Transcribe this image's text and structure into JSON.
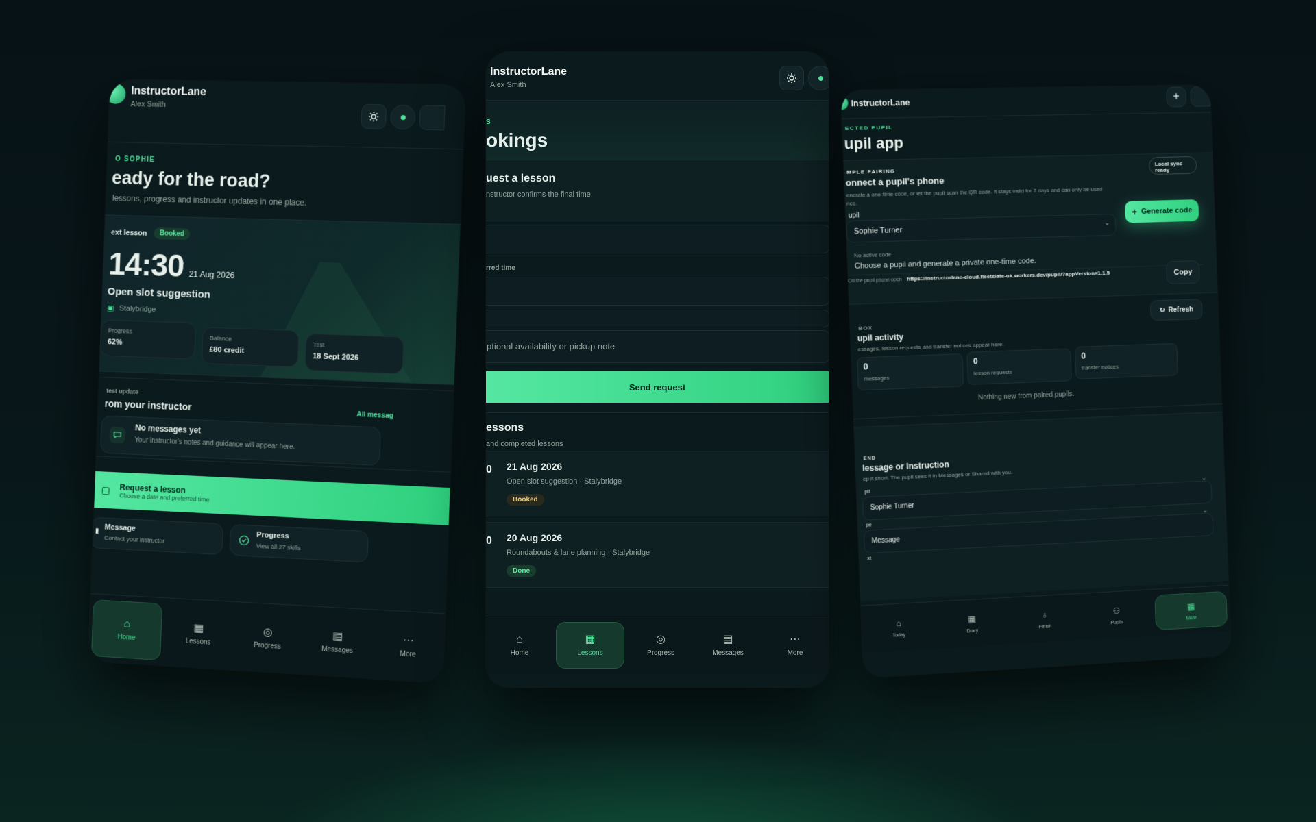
{
  "phone1": {
    "brand": "InstructorLane",
    "user": "Alex Smith",
    "greeting_eyebrow": "O SOPHIE",
    "hero_title": "eady for the road?",
    "hero_sub": "lessons, progress and instructor updates in one place.",
    "next_label": "ext lesson",
    "next_badge": "Booked",
    "next_time": "14:30",
    "next_date": "21 Aug 2026",
    "next_title": "Open slot suggestion",
    "next_location": "Stalybridge",
    "stats": [
      {
        "label": "Progress",
        "value": "62%"
      },
      {
        "label": "Balance",
        "value": "£80 credit"
      },
      {
        "label": "Test",
        "value": "18 Sept 2026"
      }
    ],
    "update_eyebrow": "test update",
    "update_title": "rom your instructor",
    "update_link": "All messag",
    "empty_title": "No messages yet",
    "empty_sub": "Your instructor's notes and guidance will appear here.",
    "cta_title": "Request a lesson",
    "cta_sub": "Choose a date and preferred time",
    "quick": [
      {
        "title": "Message",
        "sub": "Contact your instructor"
      },
      {
        "title": "Progress",
        "sub": "View all 27 skills"
      }
    ],
    "tabs": [
      "Home",
      "Lessons",
      "Progress",
      "Messages",
      "More"
    ]
  },
  "phone2": {
    "brand": "InstructorLane",
    "user": "Alex Smith",
    "eyebrow": "S",
    "page_title": "okings",
    "request_title": "uest a lesson",
    "request_sub": "nstructor confirms the final time.",
    "preferred_label": "rred time",
    "note_placeholder": "ptional availability or pickup note",
    "send_label": "Send request",
    "lessons_title": "essons",
    "lessons_sub": "and completed lessons",
    "lessons": [
      {
        "num": "0",
        "date": "21 Aug 2026",
        "desc": "Open slot suggestion · Stalybridge",
        "status": "Booked"
      },
      {
        "num": "0",
        "date": "20 Aug 2026",
        "desc": "Roundabouts & lane planning · Stalybridge",
        "status": "Done"
      }
    ],
    "tabs": [
      "Home",
      "Lessons",
      "Progress",
      "Messages",
      "More"
    ]
  },
  "phone3": {
    "brand": "InstructorLane",
    "eyebrow": "ECTED PUPIL",
    "page_title": "upil app",
    "pairing_eyebrow": "MPLE PAIRING",
    "pairing_title": "onnect a pupil's phone",
    "pairing_sub": "enerate a one-time code, or let the pupil scan the QR code. It stays valid for 7 days and can only be used",
    "pairing_sub2": "nce.",
    "sync_badge": "Local sync ready",
    "pupil_label": "upil",
    "pupil_value": "Sophie Turner",
    "generate_label": "Generate code",
    "code_label": "No active code",
    "code_sub": "Choose a pupil and generate a private one-time code.",
    "open_label": "On the pupil phone open",
    "url": "https://instructorlane-cloud.fleetslate-uk.workers.dev/pupil/?appVersion=1.1.5",
    "copy_label": "Copy",
    "inbox_eyebrow": "BOX",
    "inbox_title": "upil activity",
    "inbox_sub": "essages, lesson requests and transfer notices appear here.",
    "refresh_label": "Refresh",
    "counters": [
      {
        "value": "0",
        "label": "messages"
      },
      {
        "value": "0",
        "label": "lesson requests"
      },
      {
        "value": "0",
        "label": "transfer notices"
      }
    ],
    "empty": "Nothing new from paired pupils.",
    "send_eyebrow": "END",
    "send_title": "lessage or instruction",
    "send_sub": "ep it short. The pupil sees it in Messages or Shared with you.",
    "send_pupil_label": "pil",
    "send_pupil_value": "Sophie Turner",
    "type_label": "pe",
    "type_value": "Message",
    "text_label": "xt",
    "tabs": [
      "Today",
      "Diary",
      "Finish",
      "Pupils",
      "More"
    ]
  }
}
